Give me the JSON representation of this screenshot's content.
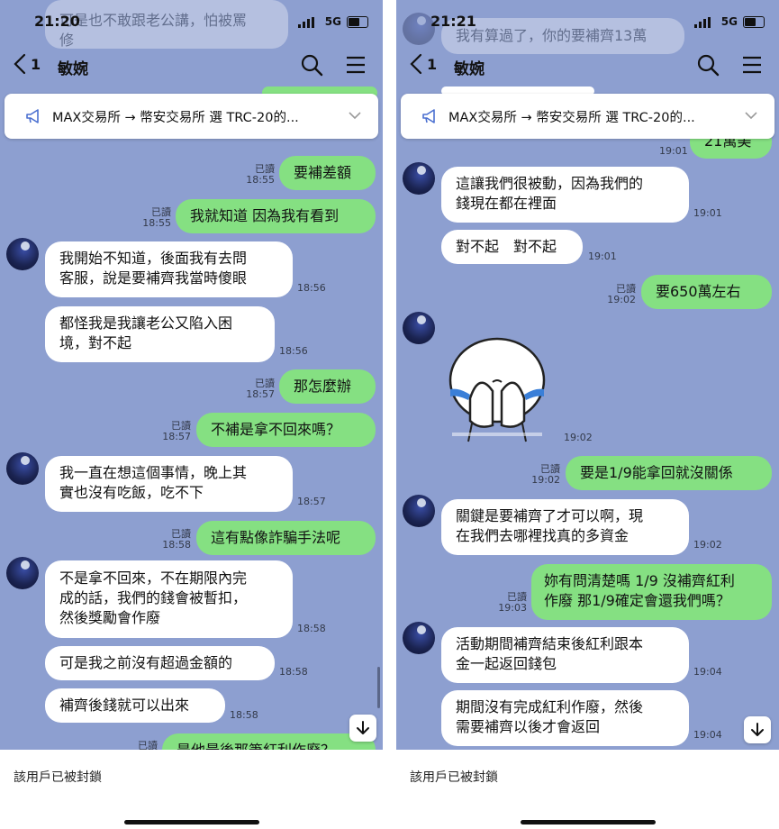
{
  "left": {
    "status": {
      "time": "21:20",
      "network": "5G"
    },
    "header": {
      "back_count": "1",
      "contact_name": "敏婉"
    },
    "notice": {
      "text": "MAX交易所 → 幣安交易所 選 TRC-20的..."
    },
    "top_partial": {
      "text": "可是也不敢跟老公講，怕被罵",
      "text2": "修"
    },
    "messages": [
      {
        "type": "out",
        "text": "要補差額",
        "read": "已讀",
        "time": "18:55"
      },
      {
        "type": "out",
        "text": "我就知道 因為我有看到",
        "read": "已讀",
        "time": "18:55"
      },
      {
        "type": "in",
        "lines": [
          "我開始不知道，後面我有去問",
          "客服，說是要補齊我當時傻眼"
        ],
        "time": "18:56"
      },
      {
        "type": "in",
        "lines": [
          "都怪我是我讓老公又陷入困",
          "境，對不起"
        ],
        "time": "18:56"
      },
      {
        "type": "out",
        "text": "那怎麼辦",
        "read": "已讀",
        "time": "18:57"
      },
      {
        "type": "out",
        "text": "不補是拿不回來嗎？",
        "read": "已讀",
        "time": "18:57"
      },
      {
        "type": "in",
        "lines": [
          "我一直在想這個事情，晚上其",
          "實也沒有吃飯，吃不下"
        ],
        "time": "18:57"
      },
      {
        "type": "out",
        "text": "這有點像詐騙手法呢",
        "read": "已讀",
        "time": "18:58"
      },
      {
        "type": "in",
        "lines": [
          "不是拿不回來，不在期限內完",
          "成的話，我們的錢會被暫扣，",
          "然後獎勵會作廢"
        ],
        "time": "18:58"
      },
      {
        "type": "in",
        "lines": [
          "可是我之前沒有超過金額的"
        ],
        "time": "18:58"
      },
      {
        "type": "in",
        "lines": [
          "補齊後錢就可以出來"
        ],
        "time": "18:58"
      },
      {
        "type": "out",
        "text": "是他最後那筆紅利作廢？",
        "read": "已讀",
        "time": ""
      }
    ],
    "footer": {
      "blocked_text": "該用戶已被封鎖"
    }
  },
  "right": {
    "status": {
      "time": "21:21",
      "network": "5G"
    },
    "header": {
      "back_count": "1",
      "contact_name": "敏婉"
    },
    "notice": {
      "text": "MAX交易所 → 幣安交易所 選 TRC-20的..."
    },
    "top_partial": {
      "text": "我有算過了，你的要補齊13萬",
      "text2": "21萬美",
      "time2": "19:01"
    },
    "messages": [
      {
        "type": "in",
        "lines": [
          "這讓我們很被動，因為我們的",
          "錢現在都在裡面"
        ],
        "time": "19:01"
      },
      {
        "type": "in",
        "lines": [
          "對不起　對不起"
        ],
        "time": "19:01"
      },
      {
        "type": "out",
        "text": "要650萬左右",
        "read": "已讀",
        "time": "19:02"
      },
      {
        "type": "sticker",
        "name": "crying-sticker",
        "time": "19:02"
      },
      {
        "type": "out",
        "text": "要是1/9能拿回就沒關係",
        "read": "已讀",
        "time": "19:02"
      },
      {
        "type": "in",
        "lines": [
          "關鍵是要補齊了才可以啊，現",
          "在我們去哪裡找真的多資金"
        ],
        "time": "19:02"
      },
      {
        "type": "out",
        "lines": [
          "妳有問清楚嗎 1/9 沒補齊紅利",
          "作廢 那1/9確定會還我們嗎？"
        ],
        "read": "已讀",
        "time": "19:03"
      },
      {
        "type": "in",
        "lines": [
          "活動期間補齊結束後紅利跟本",
          "金一起返回錢包"
        ],
        "time": "19:04"
      },
      {
        "type": "in",
        "lines": [
          "期間沒有完成紅利作廢，然後",
          "需要補齊以後才會返回"
        ],
        "time": "19:04"
      }
    ],
    "footer": {
      "blocked_text": "該用戶已被封鎖"
    }
  },
  "colors": {
    "chat_bg": "#8d9fd0",
    "outgoing": "#85e082",
    "incoming": "#ffffff"
  }
}
